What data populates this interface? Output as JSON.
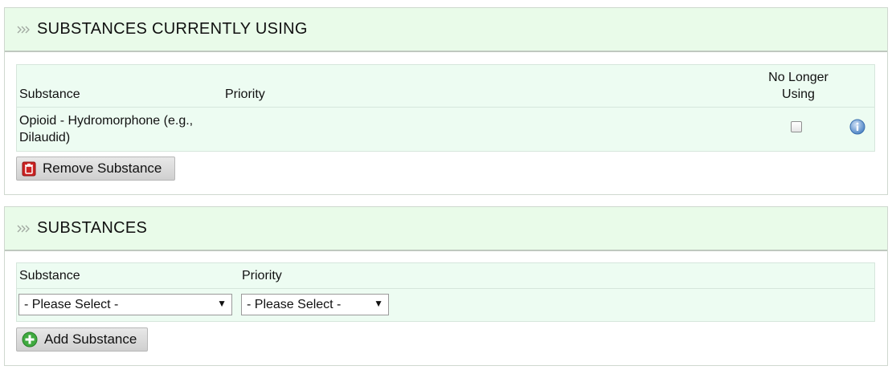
{
  "current_panel": {
    "title": "SUBSTANCES CURRENTLY USING",
    "columns": {
      "substance": "Substance",
      "priority": "Priority",
      "no_longer_using": "No Longer Using"
    },
    "rows": [
      {
        "substance": "Opioid - Hydromorphone (e.g., Dilaudid)",
        "priority": "",
        "no_longer_using": false
      }
    ],
    "remove_button": "Remove Substance"
  },
  "substances_panel": {
    "title": "SUBSTANCES",
    "columns": {
      "substance": "Substance",
      "priority": "Priority"
    },
    "substance_select": "- Please Select -",
    "priority_select": "- Please Select -",
    "add_button": "Add Substance"
  },
  "colors": {
    "header_bg": "#e9fbe9",
    "grid_bg": "#edfcf2",
    "remove_icon": "#cc2222",
    "add_icon": "#3faa3f",
    "info_icon": "#4f86c6"
  },
  "icons": [
    "grip-icon",
    "trash-icon",
    "plus-circle-icon",
    "info-icon",
    "chevron-down-icon"
  ]
}
